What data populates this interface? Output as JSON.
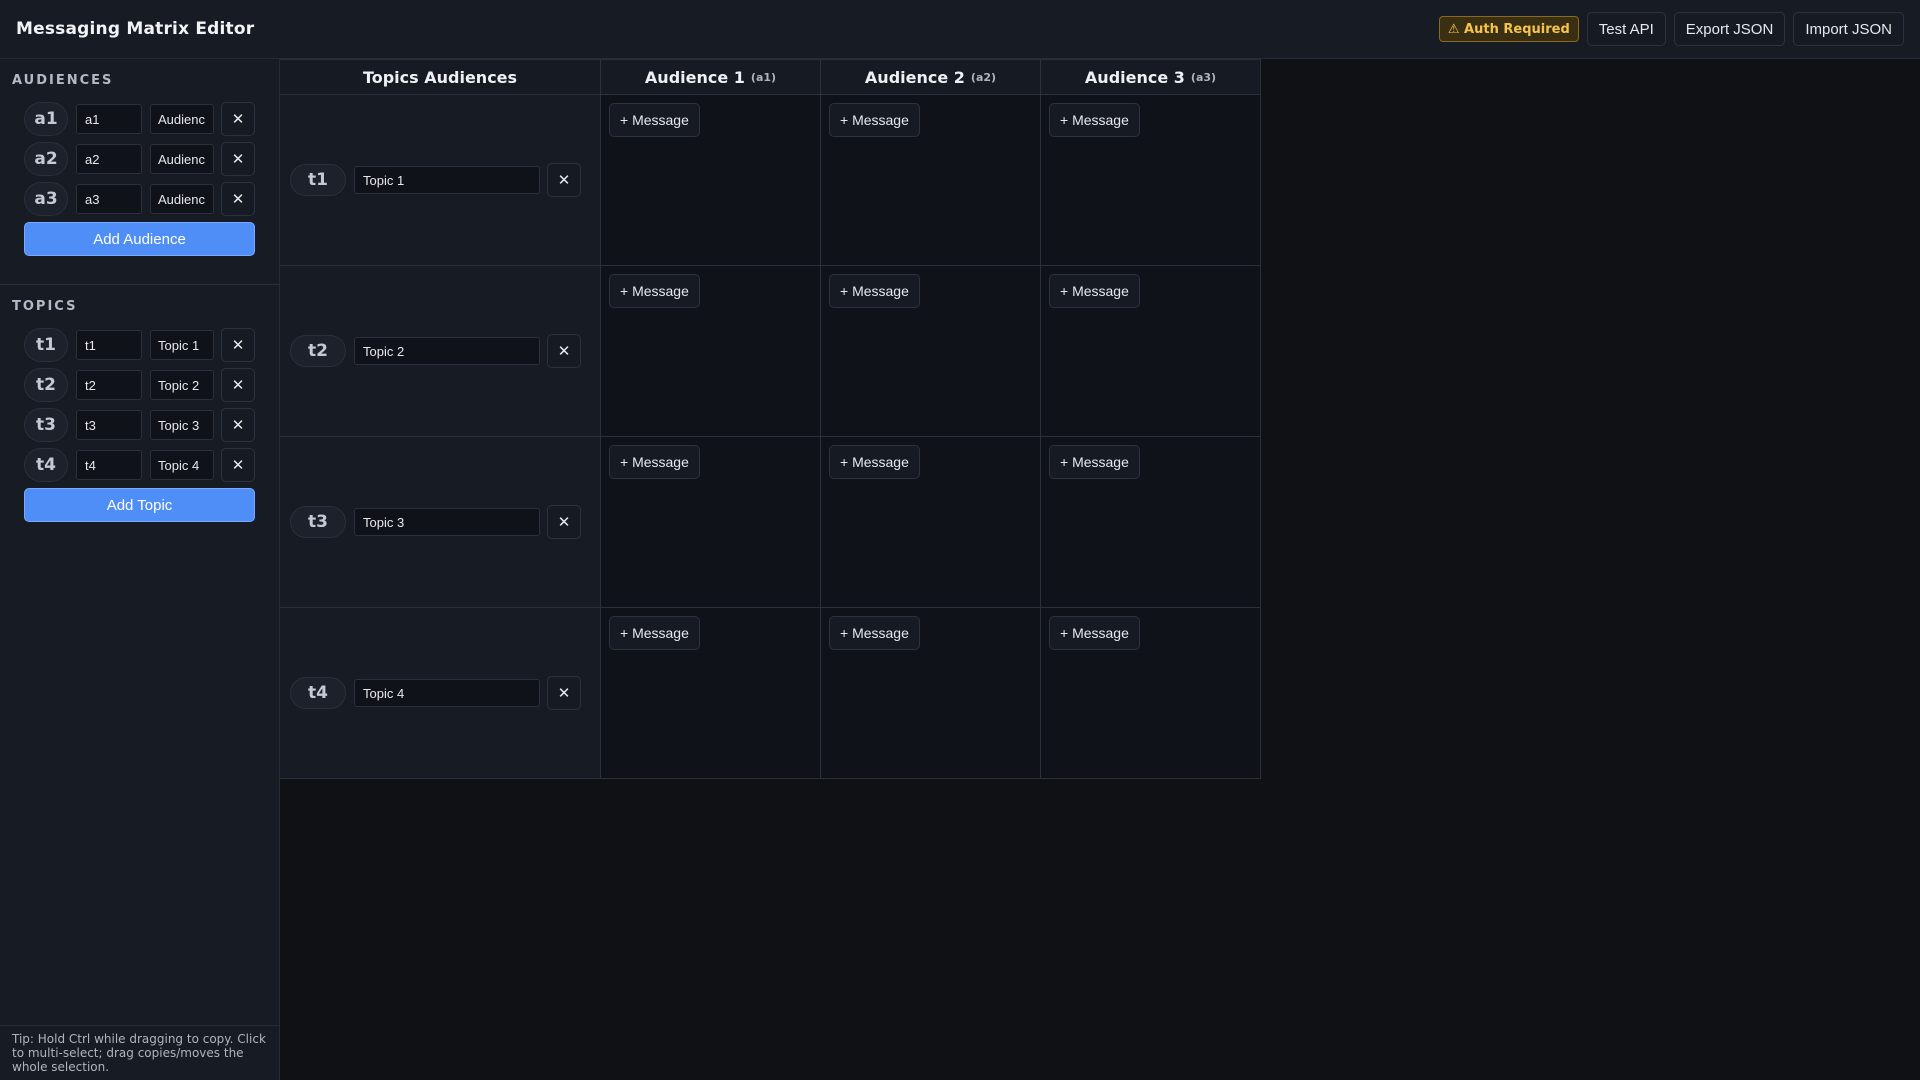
{
  "app": {
    "title": "Messaging Matrix Editor"
  },
  "toolbar": {
    "auth_badge": "⚠ Auth Required",
    "test_api": "Test API",
    "export_json": "Export JSON",
    "import_json": "Import JSON"
  },
  "sidebar": {
    "audiences_title": "AUDIENCES",
    "audiences": [
      {
        "chip": "a1",
        "id": "a1",
        "name": "Audienc",
        "remove": "✕"
      },
      {
        "chip": "a2",
        "id": "a2",
        "name": "Audienc",
        "remove": "✕"
      },
      {
        "chip": "a3",
        "id": "a3",
        "name": "Audienc",
        "remove": "✕"
      }
    ],
    "add_audience": "Add Audience",
    "topics_title": "TOPICS",
    "topics": [
      {
        "chip": "t1",
        "id": "t1",
        "name": "Topic 1",
        "remove": "✕"
      },
      {
        "chip": "t2",
        "id": "t2",
        "name": "Topic 2",
        "remove": "✕"
      },
      {
        "chip": "t3",
        "id": "t3",
        "name": "Topic 3",
        "remove": "✕"
      },
      {
        "chip": "t4",
        "id": "t4",
        "name": "Topic 4",
        "remove": "✕"
      }
    ],
    "add_topic": "Add Topic",
    "tip": "Tip: Hold Ctrl while dragging to copy. Click to multi-select; drag copies/moves the whole selection."
  },
  "matrix": {
    "corner_label": "Topics Audiences",
    "columns": [
      {
        "label": "Audience 1",
        "code": "(a1)"
      },
      {
        "label": "Audience 2",
        "code": "(a2)"
      },
      {
        "label": "Audience 3",
        "code": "(a3)"
      }
    ],
    "rows": [
      {
        "chip": "t1",
        "name": "Topic 1",
        "remove": "✕"
      },
      {
        "chip": "t2",
        "name": "Topic 2",
        "remove": "✕"
      },
      {
        "chip": "t3",
        "name": "Topic 3",
        "remove": "✕"
      },
      {
        "chip": "t4",
        "name": "Topic 4",
        "remove": "✕"
      }
    ],
    "message_button": "+ Message"
  }
}
